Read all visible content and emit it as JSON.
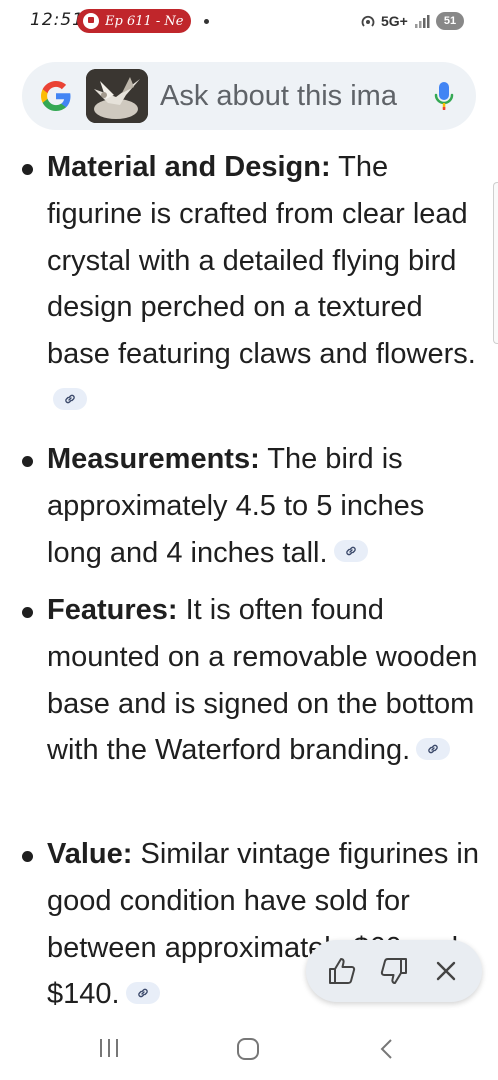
{
  "status_bar": {
    "time": "12:51",
    "notification": "Ep 611 - Ne",
    "network": "5G+",
    "battery": "51"
  },
  "search": {
    "placeholder": "Ask about this ima"
  },
  "items": [
    {
      "label": "Material and Design:",
      "text": " The figurine is crafted from clear lead crystal with a detailed flying bird design perched on a textured base featuring claws and flowers."
    },
    {
      "label": "Measurements:",
      "text": " The bird is approximately 4.5 to 5 inches long and 4 inches tall."
    },
    {
      "label": "Features:",
      "text": " It is often found mounted on a removable wooden base and is signed on the bottom with the Waterford branding."
    },
    {
      "label": "Value:",
      "text": " Similar vintage figurines in good condition have sold for between approximately $60 and $140."
    }
  ],
  "icons": {
    "google_logo": "google-logo",
    "mic": "mic-icon",
    "link": "link-icon",
    "thumbs_up": "thumbs-up-icon",
    "thumbs_down": "thumbs-down-icon",
    "close": "close-icon",
    "recents": "recents-icon",
    "home": "home-icon",
    "back": "back-icon"
  },
  "colors": {
    "notification_pill": "#c0262b",
    "search_bg": "#eef2f6",
    "link_chip": "#e8eef8",
    "text": "#1f1f1f"
  }
}
